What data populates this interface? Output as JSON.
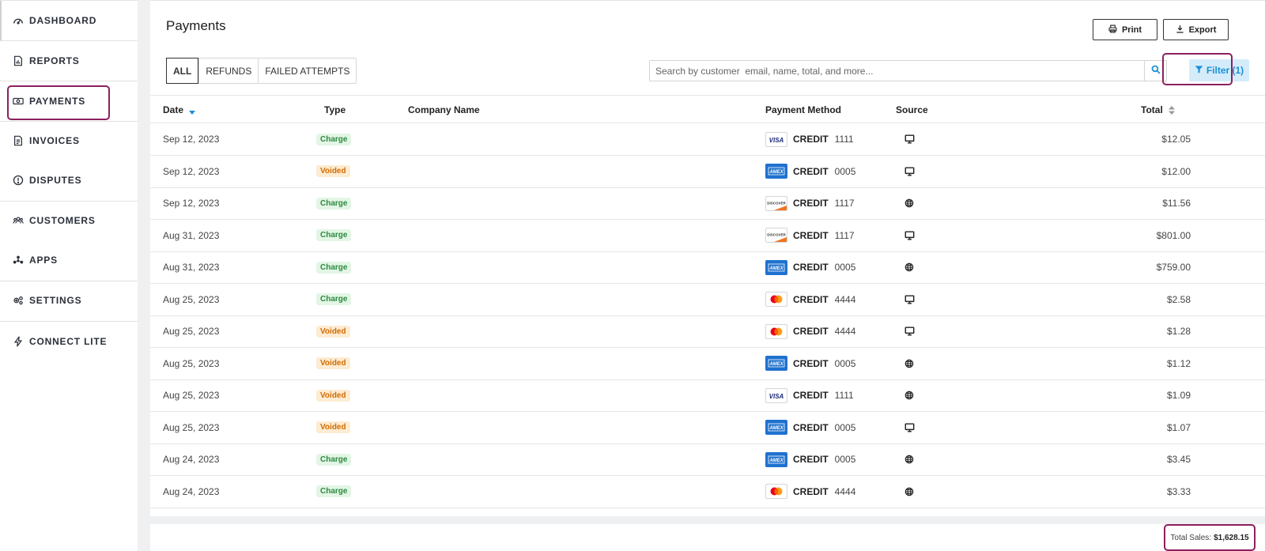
{
  "sidebar": {
    "items": [
      {
        "label": "DASHBOARD",
        "icon": "speedometer-icon"
      },
      {
        "label": "REPORTS",
        "icon": "report-icon"
      },
      {
        "label": "PAYMENTS",
        "icon": "cash-icon"
      },
      {
        "label": "INVOICES",
        "icon": "invoice-icon"
      },
      {
        "label": "DISPUTES",
        "icon": "alert-circle-icon"
      },
      {
        "label": "CUSTOMERS",
        "icon": "users-icon"
      },
      {
        "label": "APPS",
        "icon": "apps-icon"
      },
      {
        "label": "SETTINGS",
        "icon": "gears-icon"
      },
      {
        "label": "CONNECT LITE",
        "icon": "lightning-icon"
      }
    ],
    "active": "PAYMENTS"
  },
  "header": {
    "title": "Payments",
    "print_label": "Print",
    "export_label": "Export"
  },
  "tabs": [
    "ALL",
    "REFUNDS",
    "FAILED ATTEMPTS"
  ],
  "active_tab": "ALL",
  "search": {
    "placeholder": "Search by customer  email, name, total, and more..."
  },
  "filter": {
    "label": "Filter (1)"
  },
  "table": {
    "columns": {
      "date": "Date",
      "type": "Type",
      "company": "Company Name",
      "payment_method": "Payment Method",
      "source": "Source",
      "total": "Total"
    },
    "rows": [
      {
        "date": "Sep 12, 2023",
        "type": "Charge",
        "card": "VISA",
        "method": "CREDIT",
        "last4": "1111",
        "source": "desktop",
        "total": "$12.05"
      },
      {
        "date": "Sep 12, 2023",
        "type": "Voided",
        "card": "AMEX",
        "method": "CREDIT",
        "last4": "0005",
        "source": "desktop",
        "total": "$12.00"
      },
      {
        "date": "Sep 12, 2023",
        "type": "Charge",
        "card": "DISCOVER",
        "method": "CREDIT",
        "last4": "1117",
        "source": "web",
        "total": "$11.56"
      },
      {
        "date": "Aug 31, 2023",
        "type": "Charge",
        "card": "DISCOVER",
        "method": "CREDIT",
        "last4": "1117",
        "source": "desktop",
        "total": "$801.00"
      },
      {
        "date": "Aug 31, 2023",
        "type": "Charge",
        "card": "AMEX",
        "method": "CREDIT",
        "last4": "0005",
        "source": "web",
        "total": "$759.00"
      },
      {
        "date": "Aug 25, 2023",
        "type": "Charge",
        "card": "MASTERCARD",
        "method": "CREDIT",
        "last4": "4444",
        "source": "desktop",
        "total": "$2.58"
      },
      {
        "date": "Aug 25, 2023",
        "type": "Voided",
        "card": "MASTERCARD",
        "method": "CREDIT",
        "last4": "4444",
        "source": "desktop",
        "total": "$1.28"
      },
      {
        "date": "Aug 25, 2023",
        "type": "Voided",
        "card": "AMEX",
        "method": "CREDIT",
        "last4": "0005",
        "source": "web",
        "total": "$1.12"
      },
      {
        "date": "Aug 25, 2023",
        "type": "Voided",
        "card": "VISA",
        "method": "CREDIT",
        "last4": "1111",
        "source": "web",
        "total": "$1.09"
      },
      {
        "date": "Aug 25, 2023",
        "type": "Voided",
        "card": "AMEX",
        "method": "CREDIT",
        "last4": "0005",
        "source": "desktop",
        "total": "$1.07"
      },
      {
        "date": "Aug 24, 2023",
        "type": "Charge",
        "card": "AMEX",
        "method": "CREDIT",
        "last4": "0005",
        "source": "web",
        "total": "$3.45"
      },
      {
        "date": "Aug 24, 2023",
        "type": "Charge",
        "card": "MASTERCARD",
        "method": "CREDIT",
        "last4": "4444",
        "source": "web",
        "total": "$3.33"
      }
    ]
  },
  "footer": {
    "total_label": "Total Sales:",
    "total_value": "$1,628.15"
  },
  "colors": {
    "accent": "#1b8fd4",
    "highlight": "#8b2060",
    "charge": "#2c8a3e",
    "voided": "#d26b00",
    "amex": "#1f72cf"
  }
}
